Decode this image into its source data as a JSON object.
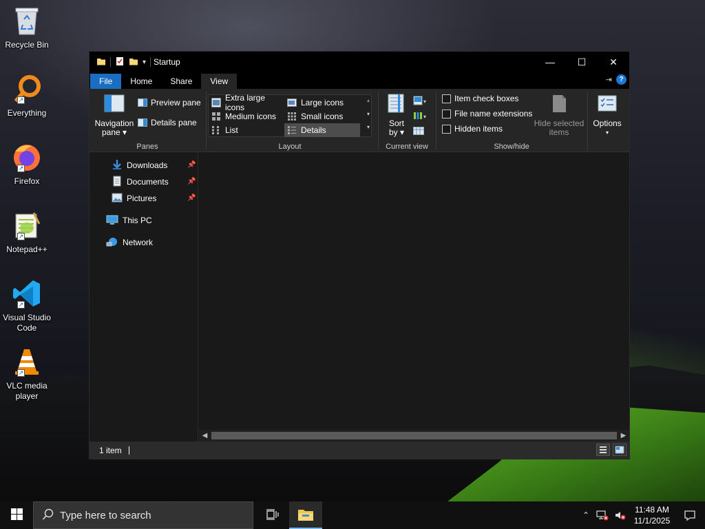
{
  "desktop": {
    "icons": [
      {
        "label": "Recycle Bin"
      },
      {
        "label": "Everything"
      },
      {
        "label": "Firefox"
      },
      {
        "label": "Notepad++"
      },
      {
        "label": "Visual Studio Code"
      },
      {
        "label": "VLC media player"
      }
    ]
  },
  "window": {
    "title": "Startup",
    "controls": {
      "minimize": "—",
      "maximize": "☐",
      "close": "✕"
    },
    "tabs": {
      "file": "File",
      "home": "Home",
      "share": "Share",
      "view": "View"
    },
    "help": "?",
    "ribbon": {
      "panes": {
        "navigation_pane_1": "Navigation",
        "navigation_pane_2": "pane",
        "preview_pane": "Preview pane",
        "details_pane": "Details pane",
        "group_label": "Panes"
      },
      "layout": {
        "extra_large_icons": "Extra large icons",
        "large_icons": "Large icons",
        "medium_icons": "Medium icons",
        "small_icons": "Small icons",
        "list": "List",
        "details": "Details",
        "group_label": "Layout"
      },
      "current_view": {
        "sort_1": "Sort",
        "sort_2": "by",
        "group_label": "Current view"
      },
      "show_hide": {
        "item_check_boxes": "Item check boxes",
        "file_name_extensions": "File name extensions",
        "hidden_items": "Hidden items",
        "hide_selected_1": "Hide selected",
        "hide_selected_2": "items",
        "group_label": "Show/hide"
      },
      "options": "Options"
    },
    "nav": {
      "downloads": "Downloads",
      "documents": "Documents",
      "pictures": "Pictures",
      "this_pc": "This PC",
      "network": "Network"
    },
    "status": {
      "item_count": "1 item"
    }
  },
  "taskbar": {
    "search_placeholder": "Type here to search",
    "time": "11:48 AM",
    "date": "11/1/2025"
  },
  "colors": {
    "accent": "#1a6ec2",
    "window_bg": "#191919",
    "ribbon_bg": "#262626"
  }
}
